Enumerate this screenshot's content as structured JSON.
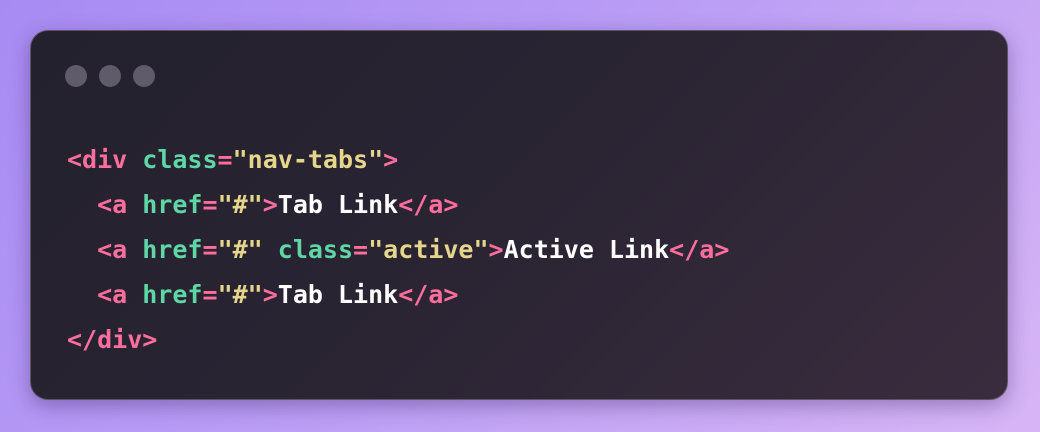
{
  "window": {
    "controls": [
      {
        "icon": "window-dot-icon"
      },
      {
        "icon": "window-dot-icon"
      },
      {
        "icon": "window-dot-icon"
      }
    ]
  },
  "colors": {
    "tag": "#ff6e9c",
    "attr": "#5fd6a5",
    "string": "#e5d68c",
    "text": "#ffffff"
  },
  "code": {
    "line1": {
      "indent": "",
      "open": "<div",
      "attr1": "class",
      "eq1": "=",
      "val1": "\"nav-tabs\"",
      "close": ">"
    },
    "line2": {
      "indent": "  ",
      "open": "<a",
      "attr1": "href",
      "eq1": "=",
      "val1": "\"#\"",
      "close": ">",
      "text": "Tab Link",
      "end": "</a>"
    },
    "line3": {
      "indent": "  ",
      "open": "<a",
      "attr1": "href",
      "eq1": "=",
      "val1": "\"#\"",
      "attr2": "class",
      "eq2": "=",
      "val2": "\"active\"",
      "close": ">",
      "text": "Active Link",
      "end": "</a>"
    },
    "line4": {
      "indent": "  ",
      "open": "<a",
      "attr1": "href",
      "eq1": "=",
      "val1": "\"#\"",
      "close": ">",
      "text": "Tab Link",
      "end": "</a>"
    },
    "line5": {
      "indent": "",
      "end": "</div>"
    }
  }
}
